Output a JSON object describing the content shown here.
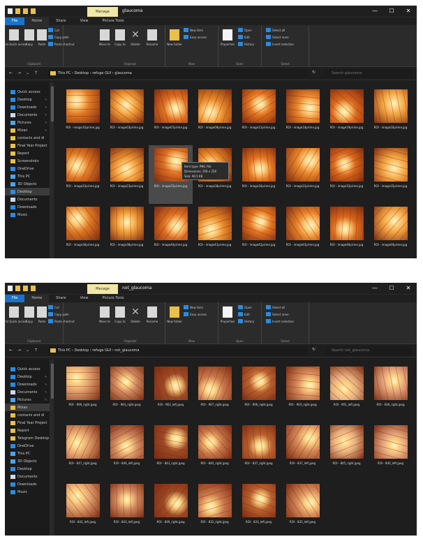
{
  "windows": [
    {
      "id": "w1",
      "tool_tab": "Manage",
      "title": "glaucoma",
      "tabs": [
        "File",
        "Home",
        "Share",
        "View",
        "Picture Tools"
      ],
      "ribbon": {
        "pin_label": "Pin to Quick access",
        "copy_label": "Copy",
        "paste_label": "Paste",
        "cut_label": "Cut",
        "copy_path_label": "Copy path",
        "paste_shortcut_label": "Paste shortcut",
        "move_label": "Move to",
        "copyto_label": "Copy to",
        "delete_label": "Delete",
        "rename_label": "Rename",
        "newfolder_label": "New folder",
        "newitem_label": "New item",
        "easyaccess_label": "Easy access",
        "properties_label": "Properties",
        "open_label": "Open",
        "edit_label": "Edit",
        "history_label": "History",
        "selectall_label": "Select all",
        "selectnone_label": "Select none",
        "invert_label": "Invert selection",
        "g_clipboard": "Clipboard",
        "g_organize": "Organize",
        "g_new": "New",
        "g_open": "Open",
        "g_select": "Select"
      },
      "path": "This PC  ›  Desktop  ›  refuge GUI  ›  glaucoma",
      "search_placeholder": "Search glaucoma",
      "nav": [
        {
          "label": "Quick access",
          "color": "#2a8be0",
          "pin": false,
          "sel": false
        },
        {
          "label": "Desktop",
          "color": "#2a8be0",
          "pin": true,
          "sel": false
        },
        {
          "label": "Downloads",
          "color": "#2a8be0",
          "pin": true,
          "sel": false
        },
        {
          "label": "Documents",
          "color": "#cfd8e6",
          "pin": true,
          "sel": false
        },
        {
          "label": "Pictures",
          "color": "#4fa3e8",
          "pin": true,
          "sel": false
        },
        {
          "label": "Mizan",
          "color": "#e8c14a",
          "pin": true,
          "sel": false
        },
        {
          "label": "contacts and di",
          "color": "#e8c14a",
          "pin": false,
          "sel": false
        },
        {
          "label": "Final Year Project",
          "color": "#e8c14a",
          "pin": false,
          "sel": false
        },
        {
          "label": "Report",
          "color": "#e8c14a",
          "pin": false,
          "sel": false
        },
        {
          "label": "Screenshots",
          "color": "#e8c14a",
          "pin": false,
          "sel": false
        },
        {
          "label": "OneDrive",
          "color": "#2a8be0",
          "pin": false,
          "sel": false
        },
        {
          "label": "This PC",
          "color": "#4fa3e8",
          "pin": false,
          "sel": false
        },
        {
          "label": "3D Objects",
          "color": "#4fa3e8",
          "pin": false,
          "sel": false
        },
        {
          "label": "Desktop",
          "color": "#2a8be0",
          "pin": false,
          "sel": true
        },
        {
          "label": "Documents",
          "color": "#cfd8e6",
          "pin": false,
          "sel": false
        },
        {
          "label": "Downloads",
          "color": "#2a8be0",
          "pin": false,
          "sel": false
        },
        {
          "label": "Music",
          "color": "#2a8be0",
          "pin": false,
          "sel": false
        }
      ],
      "files": [
        "ROI - image1Oprime.jpg",
        "ROI - image03prime.jpg",
        "ROI - image07prime.jpg",
        "ROI - image09prime.jpg",
        "ROI - image11prime.jpg",
        "ROI - image14prime.jpg",
        "ROI - image19prime.jpg",
        "ROI - image20prime.jpg",
        "ROI - image22prime.jpg",
        "ROI - image23prime.jpg",
        "ROI - image25prime.jpg",
        "ROI - image28prime.jpg",
        "ROI - image30prime.jpg",
        "ROI - image31prime.jpg",
        "ROI - image32prime.jpg",
        "ROI - image35prime.jpg",
        "ROI - image36prime.jpg",
        "ROI - image38prime.jpg",
        "ROI - image40prime.jpg",
        "ROI - image41prime.jpg",
        "ROI - image42prime.jpg",
        "ROI - image45prime.jpg",
        "ROI - image46prime.jpg",
        "ROI - image49prime.jpg"
      ],
      "highlight_index": 10,
      "tooltip": {
        "line1": "Item type: PNG File",
        "line2": "Dimensions: 256 x 256",
        "line3": "Size: 90.5 KB"
      }
    },
    {
      "id": "w2",
      "tool_tab": "Manage",
      "title": "not_glaucoma",
      "tabs": [
        "File",
        "Home",
        "Share",
        "View",
        "Picture Tools"
      ],
      "ribbon": {
        "pin_label": "Pin to Quick access",
        "copy_label": "Copy",
        "paste_label": "Paste",
        "cut_label": "Cut",
        "copy_path_label": "Copy path",
        "paste_shortcut_label": "Paste shortcut",
        "move_label": "Move to",
        "copyto_label": "Copy to",
        "delete_label": "Delete",
        "rename_label": "Rename",
        "newfolder_label": "New folder",
        "newitem_label": "New item",
        "easyaccess_label": "Easy access",
        "properties_label": "Properties",
        "open_label": "Open",
        "edit_label": "Edit",
        "history_label": "History",
        "selectall_label": "Select all",
        "selectnone_label": "Select none",
        "invert_label": "Invert selection",
        "g_clipboard": "Clipboard",
        "g_organize": "Organize",
        "g_new": "New",
        "g_open": "Open",
        "g_select": "Select"
      },
      "path": "This PC  ›  Desktop  ›  refuge GUI  ›  not_glaucoma",
      "search_placeholder": "Search not_glaucoma",
      "nav": [
        {
          "label": "Quick access",
          "color": "#2a8be0",
          "pin": false,
          "sel": false
        },
        {
          "label": "Desktop",
          "color": "#2a8be0",
          "pin": true,
          "sel": false
        },
        {
          "label": "Downloads",
          "color": "#2a8be0",
          "pin": true,
          "sel": false
        },
        {
          "label": "Documents",
          "color": "#cfd8e6",
          "pin": true,
          "sel": false
        },
        {
          "label": "Pictures",
          "color": "#4fa3e8",
          "pin": true,
          "sel": false
        },
        {
          "label": "Mizan",
          "color": "#e8c14a",
          "pin": false,
          "sel": true
        },
        {
          "label": "contacts and di",
          "color": "#e8c14a",
          "pin": false,
          "sel": false
        },
        {
          "label": "Final Year Project",
          "color": "#e8c14a",
          "pin": false,
          "sel": false
        },
        {
          "label": "Report",
          "color": "#e8c14a",
          "pin": false,
          "sel": false
        },
        {
          "label": "Telegram Desktop",
          "color": "#e8c14a",
          "pin": false,
          "sel": false
        },
        {
          "label": "OneDrive",
          "color": "#2a8be0",
          "pin": false,
          "sel": false
        },
        {
          "label": "This PC",
          "color": "#4fa3e8",
          "pin": false,
          "sel": false
        },
        {
          "label": "3D Objects",
          "color": "#4fa3e8",
          "pin": false,
          "sel": false
        },
        {
          "label": "Desktop",
          "color": "#2a8be0",
          "pin": false,
          "sel": false
        },
        {
          "label": "Documents",
          "color": "#cfd8e6",
          "pin": false,
          "sel": false
        },
        {
          "label": "Downloads",
          "color": "#2a8be0",
          "pin": false,
          "sel": false
        },
        {
          "label": "Music",
          "color": "#2a8be0",
          "pin": false,
          "sel": false
        }
      ],
      "files": [
        "ROI - 969_right.jpeg",
        "ROI - 963_right.jpeg",
        "ROI - 963_left.jpeg",
        "ROI - 967_right.jpeg",
        "ROI - 906_right.jpeg",
        "ROI - 903_right.jpeg",
        "ROI - 901_left.jpeg",
        "ROI - 648_right.jpeg",
        "ROI - 647_right.jpeg",
        "ROI - 846_left.jpeg",
        "ROI - 843_right.jpeg",
        "ROI - 840_right.jpeg",
        "ROI - 837_right.jpeg",
        "ROI - 837_left.jpeg",
        "ROI - 845_right.jpeg",
        "ROI - 840_left.jpeg",
        "ROI - 842_left.jpeg",
        "ROI - 843_left.jpeg",
        "ROI - 839_right.jpeg",
        "ROI - 832_right.jpeg",
        "ROI - 833_left.jpeg",
        "ROI - 835_left.jpeg"
      ],
      "highlight_index": -1
    }
  ],
  "thumb_palettes": {
    "glaucoma": [
      "#e07a24",
      "#e88a2a",
      "#d9691c",
      "#ef9a36",
      "#e27520",
      "#f0a040",
      "#dd7022",
      "#e8862b"
    ],
    "not_glaucoma": [
      "#d58a5a",
      "#e0a06c",
      "#c9794c",
      "#e6b080",
      "#cf8a60",
      "#b8612e",
      "#e0a077",
      "#9c4a25"
    ]
  },
  "window_controls": [
    "—",
    "☐",
    "✕"
  ]
}
